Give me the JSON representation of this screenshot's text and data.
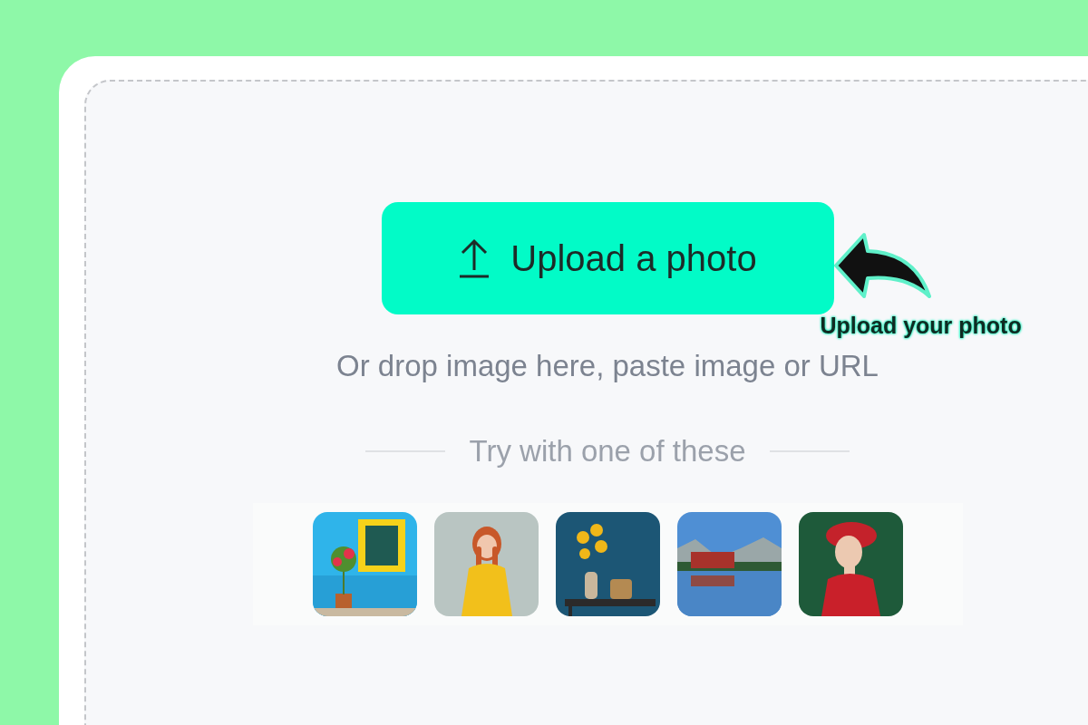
{
  "upload_button": {
    "label": "Upload a photo"
  },
  "annotation": {
    "text": "Upload your photo"
  },
  "hint": "Or drop image here, paste image or URL",
  "samples_divider": "Try with one of these"
}
